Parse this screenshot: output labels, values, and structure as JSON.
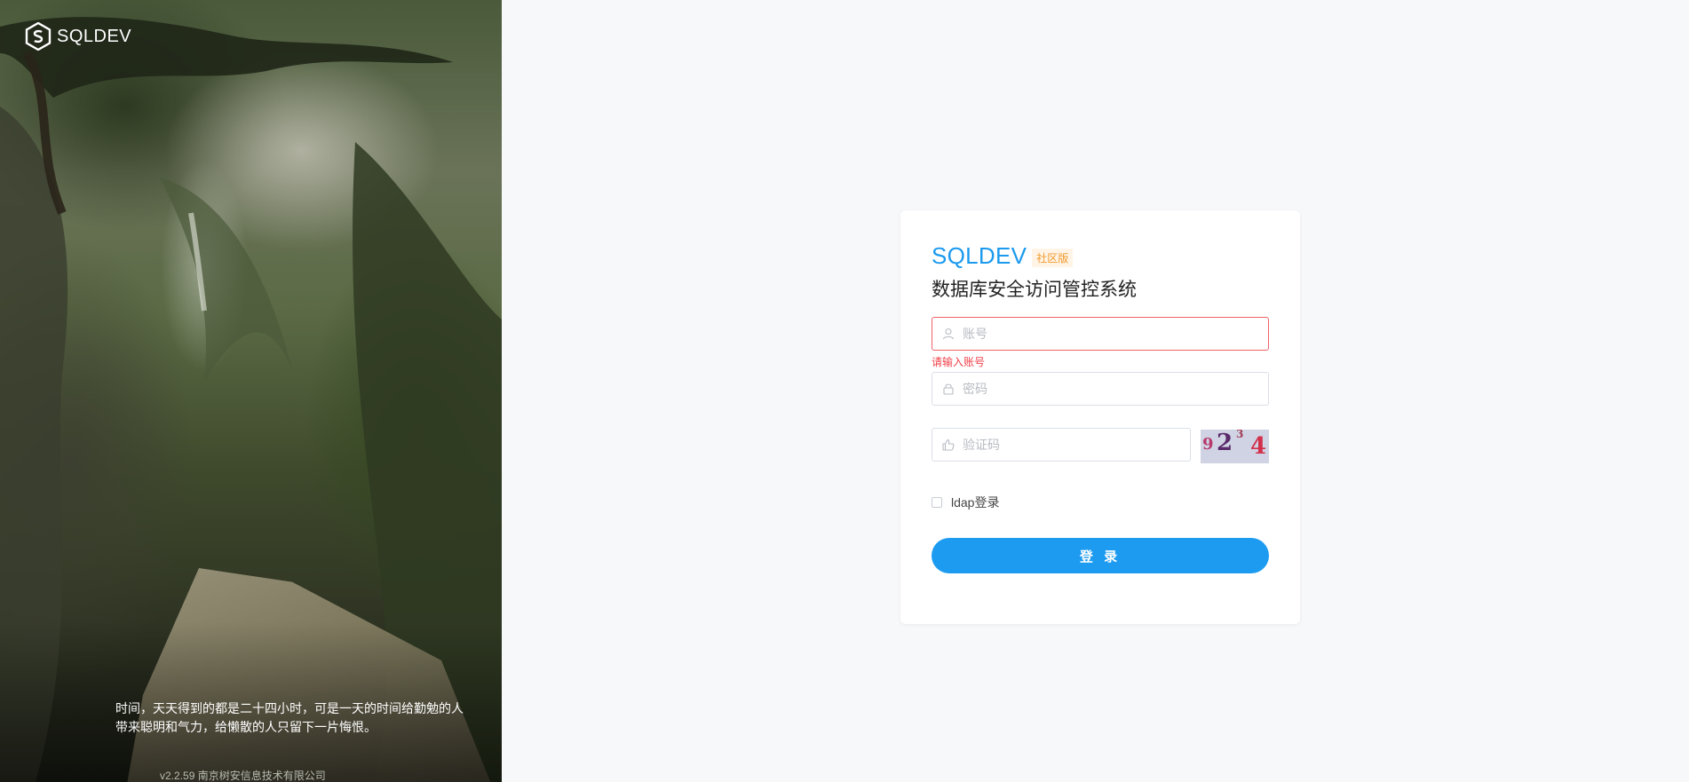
{
  "left": {
    "logo_text": "SQLDEV",
    "quote": "时间，天天得到的都是二十四小时，可是一天的时间给勤勉的人带来聪明和气力，给懒散的人只留下一片悔恨。",
    "version": "v2.2.59 南京树安信息技术有限公司"
  },
  "card": {
    "brand_name": "SQLDEV",
    "edition_badge": "社区版",
    "title": "数据库安全访问管控系统",
    "account": {
      "placeholder": "账号",
      "value": "",
      "error": "请输入账号",
      "icon": "user-icon"
    },
    "password": {
      "placeholder": "密码",
      "value": "",
      "icon": "lock-icon"
    },
    "captcha": {
      "placeholder": "验证码",
      "value": "",
      "icon": "thumb-icon",
      "image_chars": [
        "9",
        "2",
        "3",
        "4"
      ]
    },
    "ldap_label": "ldap登录",
    "ldap_checked": false,
    "login_label": "登 录"
  },
  "colors": {
    "brand": "#1b9aee",
    "button": "#1d9bf0",
    "error": "#f0414b",
    "badge_text": "#f29a2e",
    "badge_bg": "#fff4e5"
  }
}
